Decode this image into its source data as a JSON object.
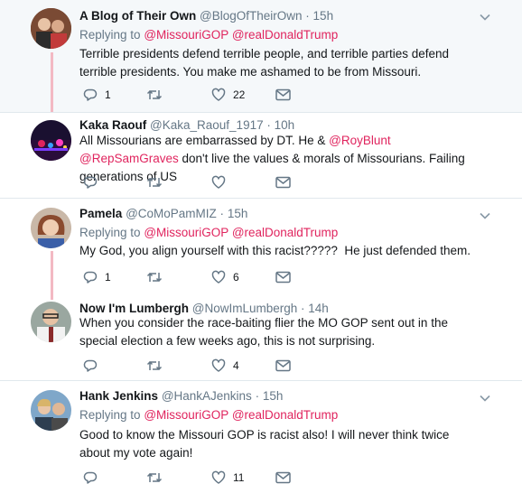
{
  "tweets": [
    {
      "name": "A Blog of Their Own",
      "handle": "@BlogOfTheirOwn",
      "dot": "·",
      "time": "15h",
      "replying_prefix": "Replying to",
      "replying_to": [
        "@MissouriGOP",
        "@realDonaldTrump"
      ],
      "text_parts": [
        "Terrible presidents defend terrible people, and terrible parties defend terrible presidents. You make me ashamed to be from Missouri."
      ],
      "replies": "1",
      "retweets": "",
      "likes": "22"
    },
    {
      "name": "Kaka Raouf",
      "handle": "@Kaka_Raouf_1917",
      "dot": "·",
      "time": "10h",
      "text_parts": [
        "All Missourians are embarrassed by DT. He & ",
        "@RoyBlunt",
        " ",
        "@RepSamGraves",
        " don't live the values & morals of Missourians. Failing generations of US"
      ],
      "replies": "",
      "retweets": "",
      "likes": ""
    },
    {
      "name": "Pamela",
      "handle": "@CoMoPamMIZ",
      "dot": "·",
      "time": "15h",
      "replying_prefix": "Replying to",
      "replying_to": [
        "@MissouriGOP",
        "@realDonaldTrump"
      ],
      "text_parts": [
        "My God, you align yourself with this racist?????  He just defended them."
      ],
      "replies": "1",
      "retweets": "",
      "likes": "6"
    },
    {
      "name": "Now I'm Lumbergh",
      "handle": "@NowImLumbergh",
      "dot": "·",
      "time": "14h",
      "text_parts": [
        "When you consider the race-baiting flier the MO GOP sent out in the special election a few weeks ago, this is not surprising."
      ],
      "replies": "",
      "retweets": "",
      "likes": "4"
    },
    {
      "name": "Hank Jenkins",
      "handle": "@HankAJenkins",
      "dot": "·",
      "time": "15h",
      "replying_prefix": "Replying to",
      "replying_to": [
        "@MissouriGOP",
        "@realDonaldTrump"
      ],
      "text_parts": [
        "Good to know the Missouri GOP is racist also! I will never think twice about my vote again!"
      ],
      "replies": "",
      "retweets": "",
      "likes": "11"
    }
  ],
  "colors": {
    "mention": "#e0245e",
    "secondary_text": "#657786",
    "thread_line": "#f3b9c3",
    "highlight_bg": "#f5f8fa",
    "separator": "#e1e8ed"
  },
  "icons": [
    "reply-icon",
    "retweet-icon",
    "like-icon",
    "dm-icon",
    "chevron-down-icon"
  ]
}
